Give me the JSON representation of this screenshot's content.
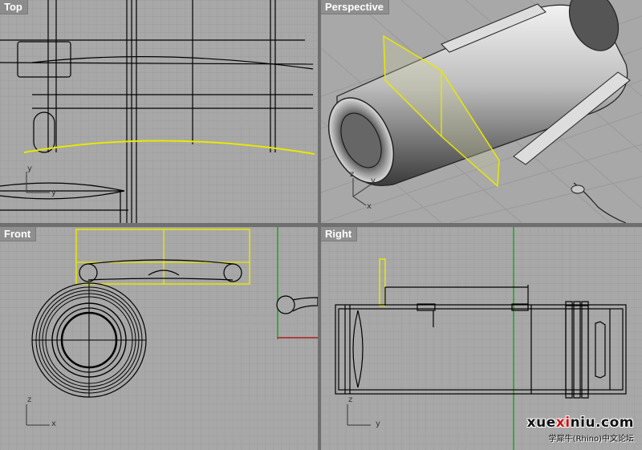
{
  "viewports": {
    "top": {
      "title": "Top",
      "axes": {
        "a": "y",
        "b": "y"
      }
    },
    "perspective": {
      "title": "Perspective",
      "axes": {
        "a": "z",
        "b": "y",
        "c": "x"
      }
    },
    "front": {
      "title": "Front",
      "axes": {
        "a": "z",
        "b": "x"
      }
    },
    "right": {
      "title": "Right",
      "axes": {
        "a": "z",
        "b": "y"
      }
    }
  },
  "watermark": {
    "site_prefix": "xue",
    "site_accent": "xi",
    "site_suffix": "niu.com",
    "subtitle": "学犀牛(Rhino)中文论坛"
  },
  "colors": {
    "viewport_bg": "#a8a8a8",
    "grid_minor": "#9c9c9c",
    "grid_major": "#8e8e8e",
    "selection": "#e8e800",
    "geometry": "#000000",
    "x_axis": "#b00000",
    "y_axis": "#00a000"
  }
}
